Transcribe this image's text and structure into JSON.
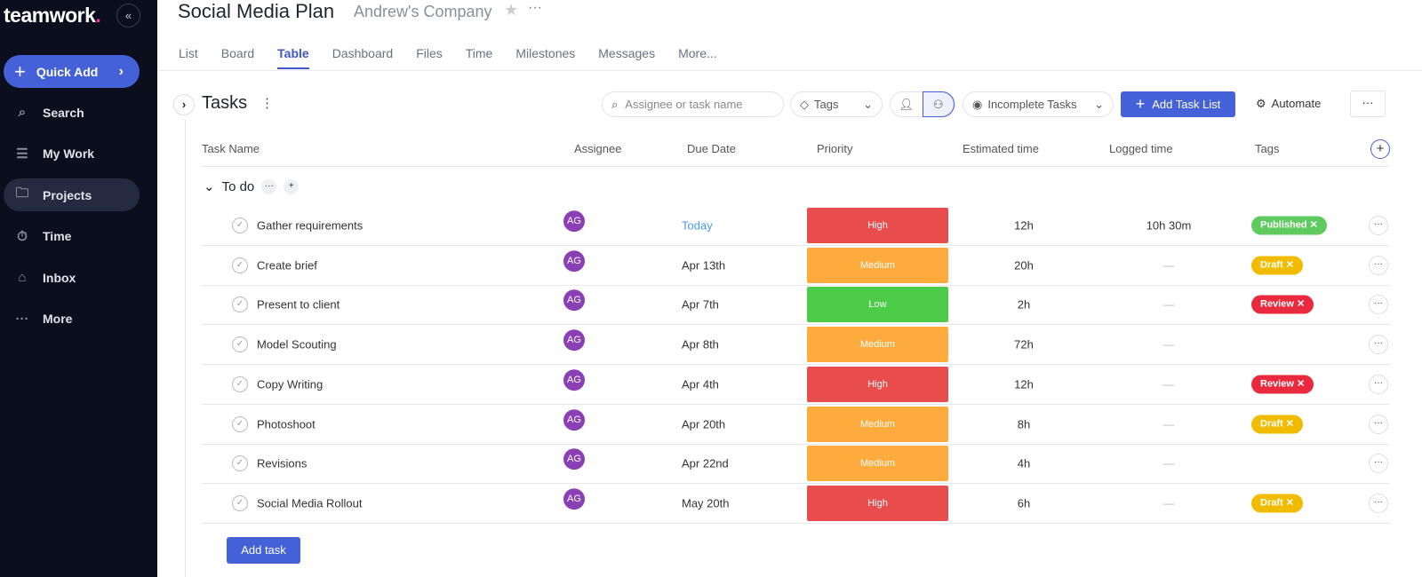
{
  "sidebar": {
    "logo": "teamwork",
    "quick_add": "Quick Add",
    "items": [
      {
        "label": "Search",
        "icon": "search-icon"
      },
      {
        "label": "My Work",
        "icon": "list-icon"
      },
      {
        "label": "Projects",
        "icon": "folder-icon",
        "active": true
      },
      {
        "label": "Time",
        "icon": "stopwatch-icon"
      },
      {
        "label": "Inbox",
        "icon": "inbox-icon"
      },
      {
        "label": "More",
        "icon": "more-icon"
      }
    ]
  },
  "header": {
    "title": "Social Media Plan",
    "company": "Andrew's Company",
    "tabs": [
      "List",
      "Board",
      "Table",
      "Dashboard",
      "Files",
      "Time",
      "Milestones",
      "Messages",
      "More..."
    ],
    "active_tab": "Table"
  },
  "toolbar": {
    "section_title": "Tasks",
    "search_placeholder": "Assignee or task name",
    "tags": "Tags",
    "filter": "Incomplete Tasks",
    "add_task_list": "Add Task List",
    "automate": "Automate"
  },
  "columns": [
    "Task Name",
    "Assignee",
    "Due Date",
    "Priority",
    "Estimated time",
    "Logged time",
    "Tags"
  ],
  "group": {
    "name": "To do"
  },
  "colors": {
    "accent": "#4461d7",
    "high": "#e84c4c",
    "medium": "#fdab3d",
    "low": "#4ccc48",
    "published": "#5fcb5f",
    "draft": "#f1bb00",
    "review": "#e8293e"
  },
  "rows": [
    {
      "name": "Gather requirements",
      "assignee": "AG",
      "due": "Today",
      "priority": "High",
      "est": "12h",
      "logged": "10h 30m",
      "tag": "Published ✕",
      "tagtype": "published"
    },
    {
      "name": "Create brief",
      "assignee": "AG",
      "due": "Apr 13th",
      "priority": "Medium",
      "est": "20h",
      "logged": "—",
      "tag": "Draft ✕",
      "tagtype": "draft"
    },
    {
      "name": "Present to client",
      "assignee": "AG",
      "due": "Apr 7th",
      "priority": "Low",
      "est": "2h",
      "logged": "—",
      "tag": "Review ✕",
      "tagtype": "review"
    },
    {
      "name": "Model Scouting",
      "assignee": "AG",
      "due": "Apr 8th",
      "priority": "Medium",
      "est": "72h",
      "logged": "—",
      "tag": "",
      "tagtype": ""
    },
    {
      "name": "Copy Writing",
      "assignee": "AG",
      "due": "Apr 4th",
      "priority": "High",
      "est": "12h",
      "logged": "—",
      "tag": "Review ✕",
      "tagtype": "review"
    },
    {
      "name": "Photoshoot",
      "assignee": "AG",
      "due": "Apr 20th",
      "priority": "Medium",
      "est": "8h",
      "logged": "—",
      "tag": "Draft ✕",
      "tagtype": "draft"
    },
    {
      "name": "Revisions",
      "assignee": "AG",
      "due": "Apr 22nd",
      "priority": "Medium",
      "est": "4h",
      "logged": "—",
      "tag": "",
      "tagtype": ""
    },
    {
      "name": "Social Media Rollout",
      "assignee": "AG",
      "due": "May 20th",
      "priority": "High",
      "est": "6h",
      "logged": "—",
      "tag": "Draft ✕",
      "tagtype": "draft"
    }
  ],
  "add_task": "Add task"
}
